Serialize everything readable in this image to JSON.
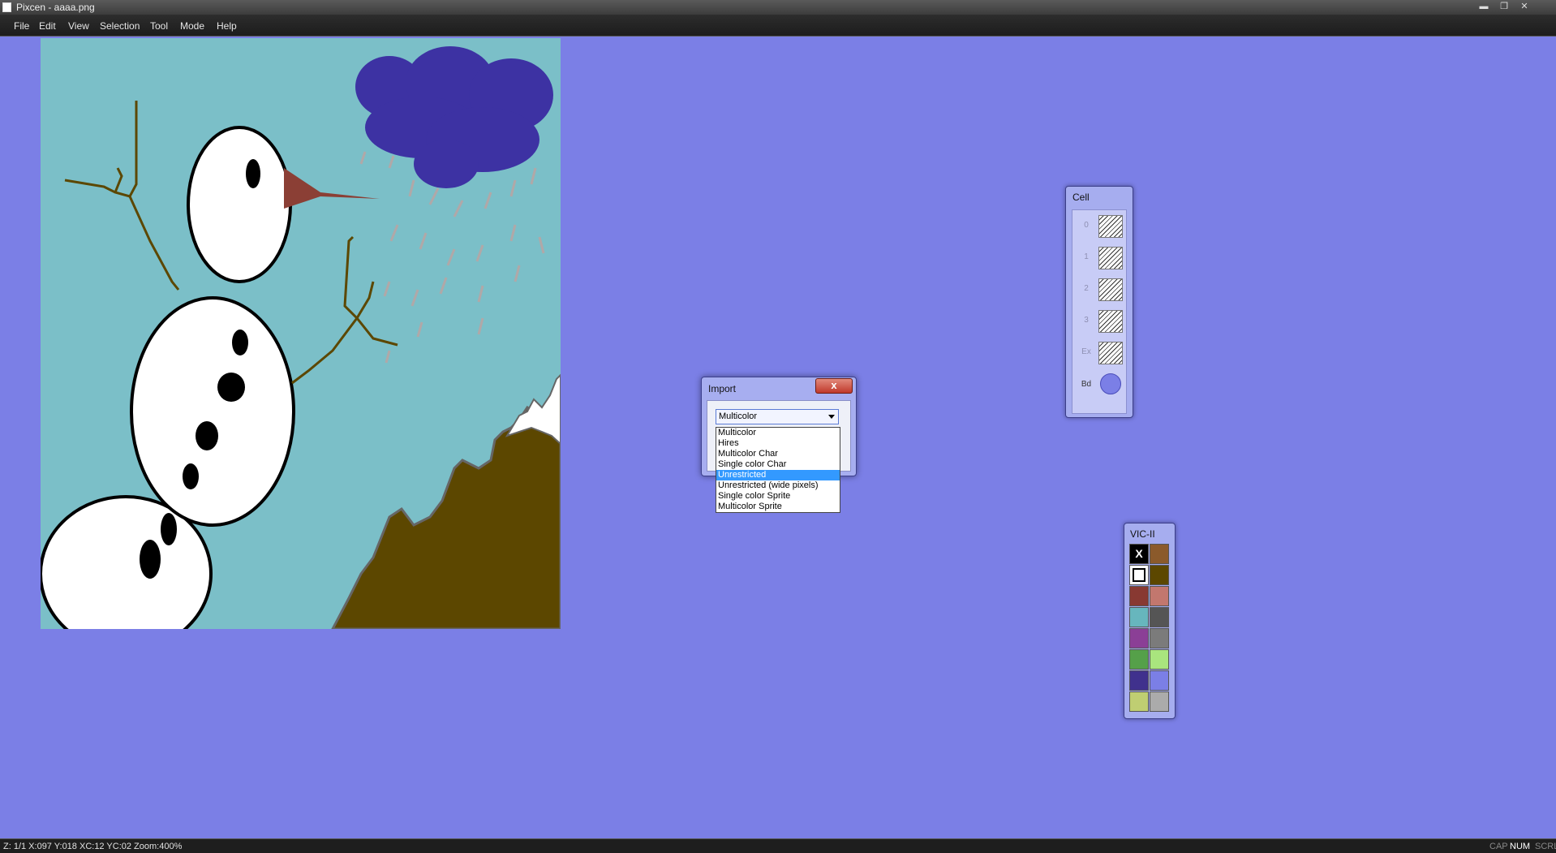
{
  "window": {
    "title": "Pixcen - aaaa.png",
    "min_glyph": "▬",
    "max_glyph": "❐",
    "close_glyph": "✕"
  },
  "menubar": {
    "items": [
      "File",
      "Edit",
      "View",
      "Selection",
      "Tool",
      "Mode",
      "Help"
    ]
  },
  "import_dialog": {
    "title": "Import",
    "close_glyph": "x",
    "selected": "Multicolor",
    "options": [
      "Multicolor",
      "Hires",
      "Multicolor Char",
      "Single color Char",
      "Unrestricted",
      "Unrestricted (wide pixels)",
      "Single color Sprite",
      "Multicolor Sprite"
    ],
    "highlighted": "Unrestricted"
  },
  "cell_panel": {
    "title": "Cell",
    "rows": [
      "0",
      "1",
      "2",
      "3",
      "Ex"
    ],
    "border_label": "Bd",
    "border_color": "#7b7fe6"
  },
  "vic_panel": {
    "title": "VIC-II",
    "selected_marker": "X",
    "colors": [
      "#000000",
      "#8b5a2b",
      "#ffffff",
      "#5c4700",
      "#883932",
      "#c2776e",
      "#67b6bd",
      "#555555",
      "#8b3f96",
      "#7b7b7b",
      "#55a049",
      "#a9e57e",
      "#40318d",
      "#7b7fe6",
      "#bfce72",
      "#ababab"
    ]
  },
  "statusbar": {
    "text": "Z: 1/1 X:097 Y:018 XC:12 YC:02 Zoom:400%",
    "indicators": [
      "CAP",
      "NUM",
      "SCRL"
    ]
  },
  "colors": {
    "background": "#7b7fe6",
    "sky": "#7bbfc8",
    "cloud": "#3d32a3",
    "ground": "#5c4700",
    "snow": "#ffffff",
    "carrot": "#8b3f35"
  }
}
